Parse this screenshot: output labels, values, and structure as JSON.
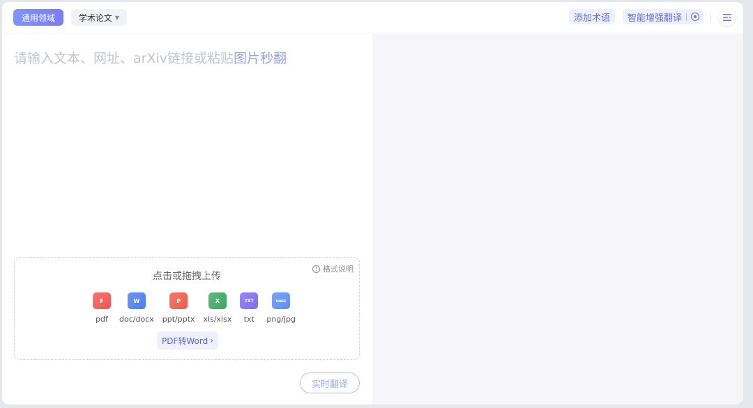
{
  "topbar": {
    "domain_button": "通用领域",
    "field_select": "学术论文",
    "add_term_button": "添加术语",
    "enhance_button": "智能增强翻译"
  },
  "editor": {
    "placeholder_main": "请输入文本、网址、arXiv链接或粘贴",
    "placeholder_highlight": "图片秒翻"
  },
  "upload": {
    "title": "点击或拖拽上传",
    "format_help": "格式说明",
    "file_types": [
      {
        "label": "pdf",
        "glyph": "F",
        "color": "#f0544f"
      },
      {
        "label": "doc/docx",
        "glyph": "W",
        "color": "#4a7cf0"
      },
      {
        "label": "ppt/pptx",
        "glyph": "P",
        "color": "#f05a4a"
      },
      {
        "label": "xls/xlsx",
        "glyph": "X",
        "color": "#3aa75f"
      },
      {
        "label": "txt",
        "glyph": "TXT",
        "color": "#7d6cf0"
      },
      {
        "label": "png/jpg",
        "glyph": "IMAGE",
        "color": "#5b8ef5"
      }
    ],
    "pdf_to_word": "PDF转Word"
  },
  "actions": {
    "realtime_translate": "实时翻译"
  }
}
